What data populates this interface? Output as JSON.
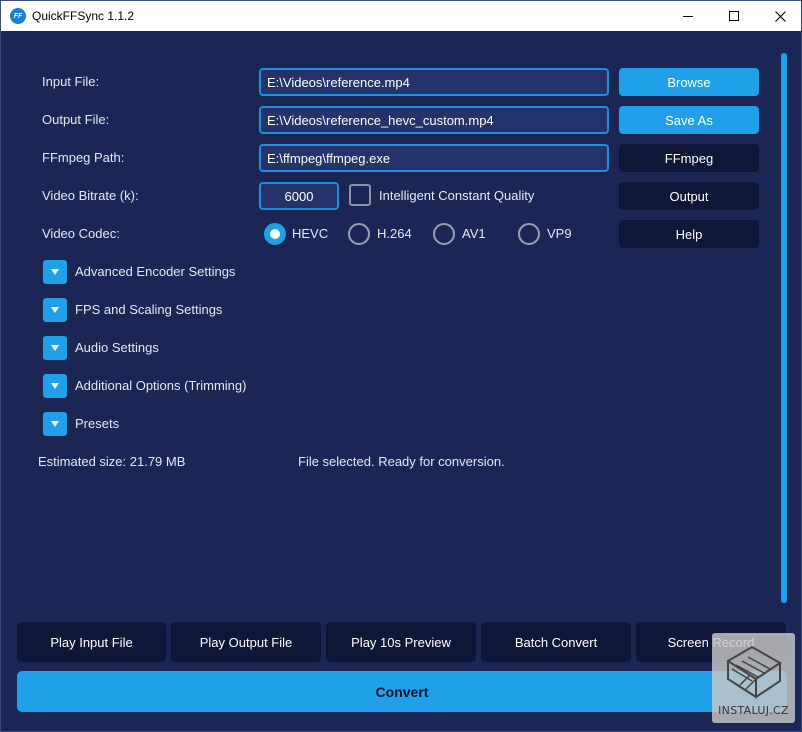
{
  "window": {
    "title": "QuickFFSync 1.1.2",
    "icon_text": "FF"
  },
  "form": {
    "input_file_label": "Input File:",
    "input_file_value": "E:\\Videos\\reference.mp4",
    "output_file_label": "Output File:",
    "output_file_value": "E:\\Videos\\reference_hevc_custom.mp4",
    "ffmpeg_path_label": "FFmpeg Path:",
    "ffmpeg_path_value": "E:\\ffmpeg\\ffmpeg.exe",
    "bitrate_label": "Video Bitrate (k):",
    "bitrate_value": "6000",
    "icq_label": "Intelligent Constant Quality",
    "codec_label": "Video Codec:",
    "codecs": [
      "HEVC",
      "H.264",
      "AV1",
      "VP9"
    ],
    "selected_codec": "HEVC"
  },
  "side_buttons": {
    "browse": "Browse",
    "save_as": "Save As",
    "ffmpeg": "FFmpeg",
    "output": "Output",
    "help": "Help"
  },
  "sections": [
    "Advanced Encoder Settings",
    "FPS and Scaling Settings",
    "Audio Settings",
    "Additional Options (Trimming)",
    "Presets"
  ],
  "status": {
    "estimated_size": "Estimated size: 21.79 MB",
    "message": "File selected. Ready for conversion."
  },
  "bottom_buttons": {
    "play_input": "Play Input File",
    "play_output": "Play Output File",
    "play_preview": "Play 10s Preview",
    "batch_convert": "Batch Convert",
    "screen_record": "Screen Record",
    "convert": "Convert"
  },
  "watermark": {
    "text": "INSTALUJ.CZ"
  },
  "colors": {
    "background": "#1b2654",
    "accent": "#1fa0e8",
    "dark_button": "#0f1738",
    "input_bg": "#24336a"
  }
}
